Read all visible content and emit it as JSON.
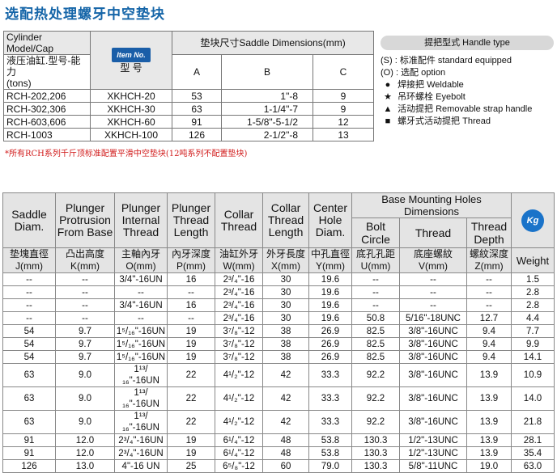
{
  "title": "选配热处理螺牙中空垫块",
  "top_table": {
    "model_header_en": "Cylinder Model/Cap",
    "model_header_cn": "液压油缸.型号-能力",
    "model_header_unit": "(tons)",
    "item_badge": "Item No.",
    "type_header": "型 号",
    "dims_header": "垫块尺寸Saddle Dimensions(mm)",
    "col_a": "A",
    "col_b": "B",
    "col_c": "C",
    "rows": [
      {
        "model": "RCH-202,206",
        "type": "XKHCH-20",
        "a": "53",
        "b": "1\"-8",
        "c": "9"
      },
      {
        "model": "RCH-302,306",
        "type": "XKHCH-30",
        "a": "63",
        "b": "1-1/4\"-7",
        "c": "9"
      },
      {
        "model": "RCH-603,606",
        "type": "XKHCH-60",
        "a": "91",
        "b": "1-5/8\"-5-1/2",
        "c": "12"
      },
      {
        "model": "RCH-1003",
        "type": "XKHCH-100",
        "a": "126",
        "b": "2-1/2\"-8",
        "c": "13"
      }
    ]
  },
  "handle_legend": {
    "heading": "提把型式 Handle type",
    "items": [
      {
        "symbol": "(S) :",
        "text": "标准配件 standard equipped"
      },
      {
        "symbol": "(O) :",
        "text": "选配 option"
      },
      {
        "symbol": "●",
        "text": "焊接把 Weldable"
      },
      {
        "symbol": "★",
        "text": "吊环螺栓 Eyebolt"
      },
      {
        "symbol": "▲",
        "text": "活动提把 Removable strap handle"
      },
      {
        "symbol": "■",
        "text": "螺牙式活动提把 Thread"
      }
    ]
  },
  "note": "*所有RCH系列千斤顶标准配置平滑中空垫块(12吨系列不配置垫块)",
  "bottom_table": {
    "headers": {
      "saddle": "Saddle Diam.",
      "saddle_cn": "垫塊直徑",
      "saddle_unit": "J(mm)",
      "protrusion": "Plunger Protrusion From Base",
      "protrusion_cn": "凸出高度",
      "protrusion_unit": "K(mm)",
      "internal": "Plunger Internal Thread",
      "internal_cn": "主軸內牙",
      "internal_unit": "O(mm)",
      "tlength": "Plunger Thread Length",
      "tlength_cn": "內牙深度",
      "tlength_unit": "P(mm)",
      "collar": "Collar Thread",
      "collar_cn": "油缸外牙",
      "collar_unit": "W(mm)",
      "collar_len": "Collar Thread Length",
      "collar_len_cn": "外牙長度",
      "collar_len_unit": "X(mm)",
      "center": "Center Hole Diam.",
      "center_cn": "中孔直徑",
      "center_unit": "Y(mm)",
      "base_group": "Base Mounting Holes Dimensions",
      "bolt": "Bolt Circle",
      "bolt_cn": "底孔孔距",
      "bolt_unit": "U(mm)",
      "thread": "Thread",
      "thread_cn": "底座螺紋",
      "thread_unit": "V(mm)",
      "depth": "Thread Depth",
      "depth_cn": "螺紋深度",
      "depth_unit": "Z(mm)",
      "kg_icon": "Kg",
      "weight": "Weight"
    },
    "rows": [
      [
        "--",
        "--",
        "3/4\"-16UN",
        "16",
        "2³/₄\"-16",
        "30",
        "19.6",
        "--",
        "--",
        "--",
        "1.5"
      ],
      [
        "--",
        "--",
        "--",
        "--",
        "2³/₄\"-16",
        "30",
        "19.6",
        "--",
        "--",
        "--",
        "2.8"
      ],
      [
        "--",
        "--",
        "3/4\"-16UN",
        "16",
        "2³/₄\"-16",
        "30",
        "19.6",
        "--",
        "--",
        "--",
        "2.8"
      ],
      [
        "--",
        "--",
        "--",
        "--",
        "2³/₄\"-16",
        "30",
        "19.6",
        "50.8",
        "5/16\"-18UNC",
        "12.7",
        "4.4"
      ],
      [
        "54",
        "9.7",
        "1⁵/₁₆\"-16UN",
        "19",
        "3⁷/₈\"-12",
        "38",
        "26.9",
        "82.5",
        "3/8\"-16UNC",
        "9.4",
        "7.7"
      ],
      [
        "54",
        "9.7",
        "1⁵/₁₆\"-16UN",
        "19",
        "3⁷/₈\"-12",
        "38",
        "26.9",
        "82.5",
        "3/8\"-16UNC",
        "9.4",
        "9.9"
      ],
      [
        "54",
        "9.7",
        "1⁵/₁₆\"-16UN",
        "19",
        "3⁷/₈\"-12",
        "38",
        "26.9",
        "82.5",
        "3/8\"-16UNC",
        "9.4",
        "14.1"
      ],
      [
        "63",
        "9.0",
        "1¹³/₁₆\"-16UN",
        "22",
        "4¹/₂\"-12",
        "42",
        "33.3",
        "92.2",
        "3/8\"-16UNC",
        "13.9",
        "10.9"
      ],
      [
        "63",
        "9.0",
        "1¹³/₁₆\"-16UN",
        "22",
        "4¹/₂\"-12",
        "42",
        "33.3",
        "92.2",
        "3/8\"-16UNC",
        "13.9",
        "14.0"
      ],
      [
        "63",
        "9.0",
        "1¹³/₁₆\"-16UN",
        "22",
        "4¹/₂\"-12",
        "42",
        "33.3",
        "92.2",
        "3/8\"-16UNC",
        "13.9",
        "21.8"
      ],
      [
        "91",
        "12.0",
        "2³/₄\"-16UN",
        "19",
        "6¹/₄\"-12",
        "48",
        "53.8",
        "130.3",
        "1/2\"-13UNC",
        "13.9",
        "28.1"
      ],
      [
        "91",
        "12.0",
        "2³/₄\"-16UN",
        "19",
        "6¹/₄\"-12",
        "48",
        "53.8",
        "130.3",
        "1/2\"-13UNC",
        "13.9",
        "35.4"
      ],
      [
        "126",
        "13.0",
        "4\"-16 UN",
        "25",
        "6⁵/₈\"-12",
        "60",
        "79.0",
        "130.3",
        "5/8\"-11UNC",
        "19.0",
        "63.0"
      ]
    ]
  }
}
